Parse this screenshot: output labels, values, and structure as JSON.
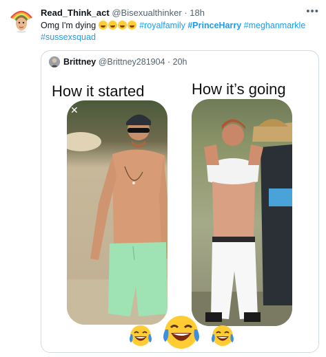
{
  "tweet": {
    "author_name": "Read_Think_act",
    "author_handle": "@Bisexualthinker",
    "separator": "·",
    "time": "18h",
    "more_icon": "more-horizontal-icon",
    "text_before_emoji": "Omg I'm dying",
    "emoji_names": [
      "rolling-on-floor-laughing-emoji",
      "rolling-on-floor-laughing-emoji",
      "rolling-on-floor-laughing-emoji",
      "rolling-on-floor-laughing-emoji"
    ],
    "hashtags": [
      "#royalfamily",
      "#PrinceHarry",
      "#meghanmarkle",
      "#sussexsquad"
    ]
  },
  "quote": {
    "author_name": "Brittney",
    "author_handle": "@Brittney281904",
    "separator": "·",
    "time": "20h",
    "meme": {
      "left_caption": "How it started",
      "right_caption": "How it’s going",
      "close_label": "✕",
      "bottom_emojis": [
        "face-with-tears-of-joy-emoji",
        "face-with-tears-of-joy-emoji",
        "face-with-tears-of-joy-emoji"
      ]
    }
  },
  "colors": {
    "link": "#1d9bf0",
    "secondary_text": "#536471",
    "border": "#cfd9de"
  }
}
